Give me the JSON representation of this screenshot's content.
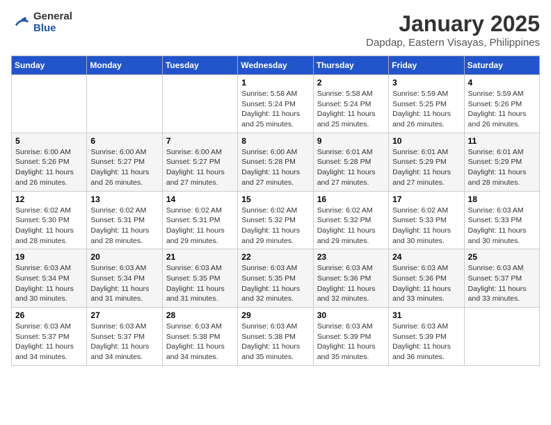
{
  "logo": {
    "general": "General",
    "blue": "Blue"
  },
  "title": "January 2025",
  "subtitle": "Dapdap, Eastern Visayas, Philippines",
  "weekdays": [
    "Sunday",
    "Monday",
    "Tuesday",
    "Wednesday",
    "Thursday",
    "Friday",
    "Saturday"
  ],
  "weeks": [
    [
      {
        "day": null,
        "sunrise": null,
        "sunset": null,
        "daylight": null
      },
      {
        "day": null,
        "sunrise": null,
        "sunset": null,
        "daylight": null
      },
      {
        "day": null,
        "sunrise": null,
        "sunset": null,
        "daylight": null
      },
      {
        "day": "1",
        "sunrise": "Sunrise: 5:58 AM",
        "sunset": "Sunset: 5:24 PM",
        "daylight": "Daylight: 11 hours and 25 minutes."
      },
      {
        "day": "2",
        "sunrise": "Sunrise: 5:58 AM",
        "sunset": "Sunset: 5:24 PM",
        "daylight": "Daylight: 11 hours and 25 minutes."
      },
      {
        "day": "3",
        "sunrise": "Sunrise: 5:59 AM",
        "sunset": "Sunset: 5:25 PM",
        "daylight": "Daylight: 11 hours and 26 minutes."
      },
      {
        "day": "4",
        "sunrise": "Sunrise: 5:59 AM",
        "sunset": "Sunset: 5:26 PM",
        "daylight": "Daylight: 11 hours and 26 minutes."
      }
    ],
    [
      {
        "day": "5",
        "sunrise": "Sunrise: 6:00 AM",
        "sunset": "Sunset: 5:26 PM",
        "daylight": "Daylight: 11 hours and 26 minutes."
      },
      {
        "day": "6",
        "sunrise": "Sunrise: 6:00 AM",
        "sunset": "Sunset: 5:27 PM",
        "daylight": "Daylight: 11 hours and 26 minutes."
      },
      {
        "day": "7",
        "sunrise": "Sunrise: 6:00 AM",
        "sunset": "Sunset: 5:27 PM",
        "daylight": "Daylight: 11 hours and 27 minutes."
      },
      {
        "day": "8",
        "sunrise": "Sunrise: 6:00 AM",
        "sunset": "Sunset: 5:28 PM",
        "daylight": "Daylight: 11 hours and 27 minutes."
      },
      {
        "day": "9",
        "sunrise": "Sunrise: 6:01 AM",
        "sunset": "Sunset: 5:28 PM",
        "daylight": "Daylight: 11 hours and 27 minutes."
      },
      {
        "day": "10",
        "sunrise": "Sunrise: 6:01 AM",
        "sunset": "Sunset: 5:29 PM",
        "daylight": "Daylight: 11 hours and 27 minutes."
      },
      {
        "day": "11",
        "sunrise": "Sunrise: 6:01 AM",
        "sunset": "Sunset: 5:29 PM",
        "daylight": "Daylight: 11 hours and 28 minutes."
      }
    ],
    [
      {
        "day": "12",
        "sunrise": "Sunrise: 6:02 AM",
        "sunset": "Sunset: 5:30 PM",
        "daylight": "Daylight: 11 hours and 28 minutes."
      },
      {
        "day": "13",
        "sunrise": "Sunrise: 6:02 AM",
        "sunset": "Sunset: 5:31 PM",
        "daylight": "Daylight: 11 hours and 28 minutes."
      },
      {
        "day": "14",
        "sunrise": "Sunrise: 6:02 AM",
        "sunset": "Sunset: 5:31 PM",
        "daylight": "Daylight: 11 hours and 29 minutes."
      },
      {
        "day": "15",
        "sunrise": "Sunrise: 6:02 AM",
        "sunset": "Sunset: 5:32 PM",
        "daylight": "Daylight: 11 hours and 29 minutes."
      },
      {
        "day": "16",
        "sunrise": "Sunrise: 6:02 AM",
        "sunset": "Sunset: 5:32 PM",
        "daylight": "Daylight: 11 hours and 29 minutes."
      },
      {
        "day": "17",
        "sunrise": "Sunrise: 6:02 AM",
        "sunset": "Sunset: 5:33 PM",
        "daylight": "Daylight: 11 hours and 30 minutes."
      },
      {
        "day": "18",
        "sunrise": "Sunrise: 6:03 AM",
        "sunset": "Sunset: 5:33 PM",
        "daylight": "Daylight: 11 hours and 30 minutes."
      }
    ],
    [
      {
        "day": "19",
        "sunrise": "Sunrise: 6:03 AM",
        "sunset": "Sunset: 5:34 PM",
        "daylight": "Daylight: 11 hours and 30 minutes."
      },
      {
        "day": "20",
        "sunrise": "Sunrise: 6:03 AM",
        "sunset": "Sunset: 5:34 PM",
        "daylight": "Daylight: 11 hours and 31 minutes."
      },
      {
        "day": "21",
        "sunrise": "Sunrise: 6:03 AM",
        "sunset": "Sunset: 5:35 PM",
        "daylight": "Daylight: 11 hours and 31 minutes."
      },
      {
        "day": "22",
        "sunrise": "Sunrise: 6:03 AM",
        "sunset": "Sunset: 5:35 PM",
        "daylight": "Daylight: 11 hours and 32 minutes."
      },
      {
        "day": "23",
        "sunrise": "Sunrise: 6:03 AM",
        "sunset": "Sunset: 5:36 PM",
        "daylight": "Daylight: 11 hours and 32 minutes."
      },
      {
        "day": "24",
        "sunrise": "Sunrise: 6:03 AM",
        "sunset": "Sunset: 5:36 PM",
        "daylight": "Daylight: 11 hours and 33 minutes."
      },
      {
        "day": "25",
        "sunrise": "Sunrise: 6:03 AM",
        "sunset": "Sunset: 5:37 PM",
        "daylight": "Daylight: 11 hours and 33 minutes."
      }
    ],
    [
      {
        "day": "26",
        "sunrise": "Sunrise: 6:03 AM",
        "sunset": "Sunset: 5:37 PM",
        "daylight": "Daylight: 11 hours and 34 minutes."
      },
      {
        "day": "27",
        "sunrise": "Sunrise: 6:03 AM",
        "sunset": "Sunset: 5:37 PM",
        "daylight": "Daylight: 11 hours and 34 minutes."
      },
      {
        "day": "28",
        "sunrise": "Sunrise: 6:03 AM",
        "sunset": "Sunset: 5:38 PM",
        "daylight": "Daylight: 11 hours and 34 minutes."
      },
      {
        "day": "29",
        "sunrise": "Sunrise: 6:03 AM",
        "sunset": "Sunset: 5:38 PM",
        "daylight": "Daylight: 11 hours and 35 minutes."
      },
      {
        "day": "30",
        "sunrise": "Sunrise: 6:03 AM",
        "sunset": "Sunset: 5:39 PM",
        "daylight": "Daylight: 11 hours and 35 minutes."
      },
      {
        "day": "31",
        "sunrise": "Sunrise: 6:03 AM",
        "sunset": "Sunset: 5:39 PM",
        "daylight": "Daylight: 11 hours and 36 minutes."
      },
      {
        "day": null,
        "sunrise": null,
        "sunset": null,
        "daylight": null
      }
    ]
  ]
}
